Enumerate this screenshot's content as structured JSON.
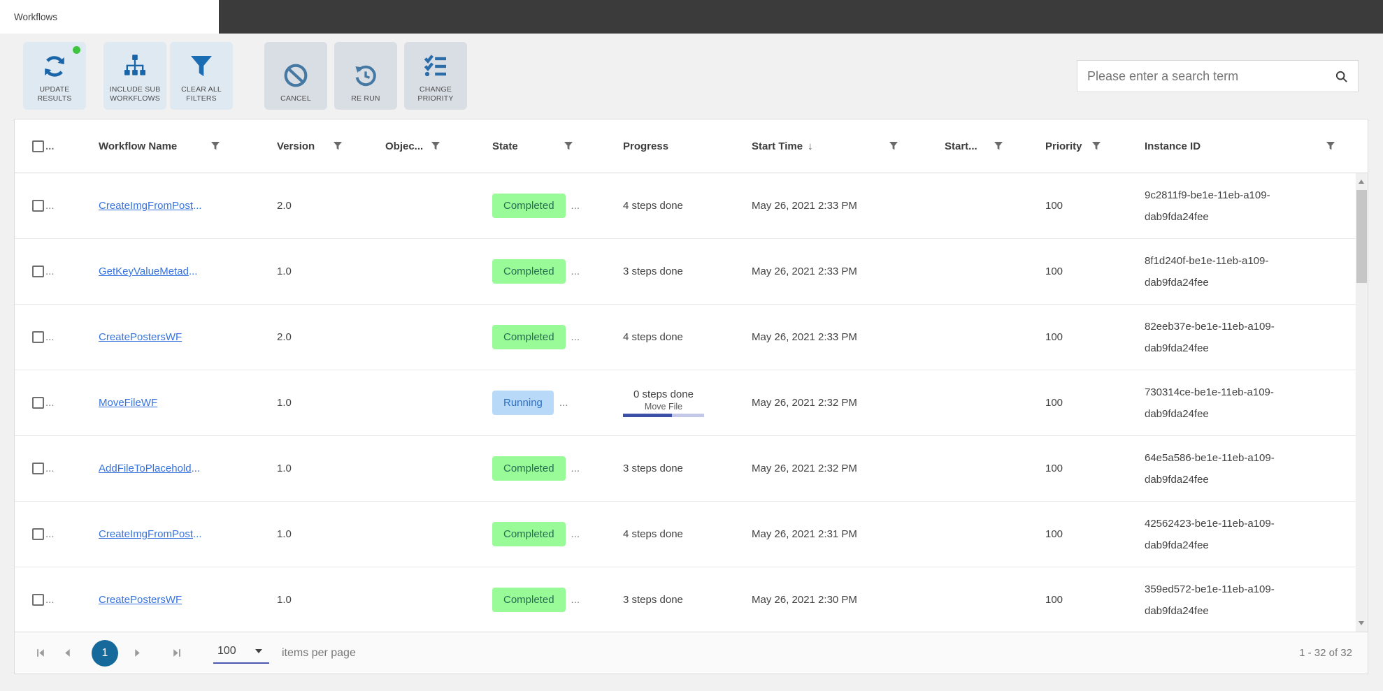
{
  "colors": {
    "primary": "#16699b",
    "link": "#3672df",
    "completed_bg": "#98fb98",
    "completed_text": "#276b52",
    "running_bg": "#b9d9f8",
    "running_text": "#2b6fc2",
    "progress_fill": "#3c50a8",
    "progress_track": "#c3c8e8",
    "toolbar_icon_blue": "#1a65a8",
    "toolbar_icon_steel": "#4579a3"
  },
  "tab": {
    "title": "Workflows"
  },
  "toolbar": {
    "update_results": {
      "line1": "UPDATE",
      "line2": "RESULTS"
    },
    "include_sub": {
      "line1": "INCLUDE SUB",
      "line2": "WORKFLOWS"
    },
    "clear_filters": {
      "line1": "CLEAR ALL",
      "line2": "FILTERS"
    },
    "cancel": {
      "line1": "CANCEL",
      "line2": ""
    },
    "rerun": {
      "line1": "RE RUN",
      "line2": ""
    },
    "change_priority": {
      "line1": "CHANGE",
      "line2": "PRIORITY"
    }
  },
  "search": {
    "placeholder": "Please enter a search term"
  },
  "table": {
    "ellipsis": "...",
    "columns": {
      "name": "Workflow Name",
      "version": "Version",
      "object": "Objec...",
      "state": "State",
      "progress": "Progress",
      "start_time": "Start Time",
      "start_time_sort": "↓",
      "started": "Start...",
      "priority": "Priority",
      "instance": "Instance ID"
    },
    "rows": [
      {
        "name": "CreateImgFromPost",
        "name_suffix": "...",
        "version": "2.0",
        "state": "Completed",
        "state_type": "completed",
        "progress": "4 steps done",
        "start_time": "May 26, 2021 2:33 PM",
        "priority": "100",
        "instance_line1": "9c2811f9-be1e-11eb-a109-",
        "instance_line2": "dab9fda24fee"
      },
      {
        "name": "GetKeyValueMetad",
        "name_suffix": "...",
        "version": "1.0",
        "state": "Completed",
        "state_type": "completed",
        "progress": "3 steps done",
        "start_time": "May 26, 2021 2:33 PM",
        "priority": "100",
        "instance_line1": "8f1d240f-be1e-11eb-a109-",
        "instance_line2": "dab9fda24fee"
      },
      {
        "name": "CreatePostersWF",
        "name_suffix": "",
        "version": "2.0",
        "state": "Completed",
        "state_type": "completed",
        "progress": "4 steps done",
        "start_time": "May 26, 2021 2:33 PM",
        "priority": "100",
        "instance_line1": "82eeb37e-be1e-11eb-a109-",
        "instance_line2": "dab9fda24fee"
      },
      {
        "name": "MoveFileWF",
        "name_suffix": "",
        "version": "1.0",
        "state": "Running",
        "state_type": "running",
        "progress": "0 steps done",
        "progress_task": "Move File",
        "progress_pct": 60,
        "start_time": "May 26, 2021 2:32 PM",
        "priority": "100",
        "instance_line1": "730314ce-be1e-11eb-a109-",
        "instance_line2": "dab9fda24fee"
      },
      {
        "name": "AddFileToPlacehold",
        "name_suffix": "...",
        "version": "1.0",
        "state": "Completed",
        "state_type": "completed",
        "progress": "3 steps done",
        "start_time": "May 26, 2021 2:32 PM",
        "priority": "100",
        "instance_line1": "64e5a586-be1e-11eb-a109-",
        "instance_line2": "dab9fda24fee"
      },
      {
        "name": "CreateImgFromPost",
        "name_suffix": "...",
        "version": "1.0",
        "state": "Completed",
        "state_type": "completed",
        "progress": "4 steps done",
        "start_time": "May 26, 2021 2:31 PM",
        "priority": "100",
        "instance_line1": "42562423-be1e-11eb-a109-",
        "instance_line2": "dab9fda24fee"
      },
      {
        "name": "CreatePostersWF",
        "name_suffix": "",
        "version": "1.0",
        "state": "Completed",
        "state_type": "completed",
        "progress": "3 steps done",
        "start_time": "May 26, 2021 2:30 PM",
        "priority": "100",
        "instance_line1": "359ed572-be1e-11eb-a109-",
        "instance_line2": "dab9fda24fee"
      }
    ]
  },
  "pager": {
    "page": "1",
    "page_size": "100",
    "items_label": "items per page",
    "range": "1 - 32 of 32"
  }
}
